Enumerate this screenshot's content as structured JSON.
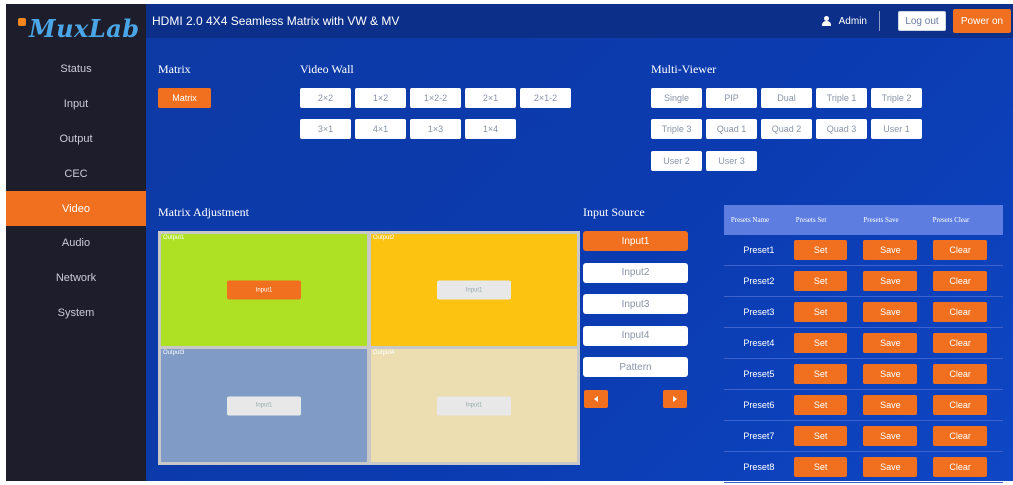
{
  "brand": {
    "logo_text": "MuxLab"
  },
  "header": {
    "title": "HDMI 2.0 4X4 Seamless Matrix with VW & MV",
    "user_name": "Admin",
    "logout_label": "Log out",
    "power_label": "Power on"
  },
  "sidebar": {
    "items": [
      {
        "label": "Status"
      },
      {
        "label": "Input"
      },
      {
        "label": "Output"
      },
      {
        "label": "CEC"
      },
      {
        "label": "Video",
        "active": true
      },
      {
        "label": "Audio"
      },
      {
        "label": "Network"
      },
      {
        "label": "System"
      }
    ]
  },
  "matrix": {
    "title": "Matrix",
    "button_label": "Matrix"
  },
  "video_wall": {
    "title": "Video Wall",
    "row1": [
      "2×2",
      "1×2",
      "1×2-2",
      "2×1",
      "2×1-2"
    ],
    "row2": [
      "3×1",
      "4×1",
      "1×3",
      "1×4"
    ]
  },
  "multi_viewer": {
    "title": "Multi-Viewer",
    "row1": [
      "Single",
      "PIP",
      "Dual",
      "Triple 1",
      "Triple 2"
    ],
    "row2": [
      "Triple 3",
      "Quad 1",
      "Quad 2",
      "Quad 3",
      "User 1"
    ],
    "row3": [
      "User 2",
      "User 3"
    ]
  },
  "matrix_adjustment": {
    "title": "Matrix Adjustment",
    "cells": [
      {
        "label": "Output1",
        "input": "Input1"
      },
      {
        "label": "Output2",
        "input": "Input1"
      },
      {
        "label": "Output3",
        "input": "Input1"
      },
      {
        "label": "Output4",
        "input": "Input1"
      }
    ]
  },
  "input_source": {
    "title": "Input Source",
    "items": [
      "Input1",
      "Input2",
      "Input3",
      "Input4",
      "Pattern"
    ]
  },
  "presets": {
    "headers": [
      "Presets Name",
      "Presets Set",
      "Presets Save",
      "Presets Clear"
    ],
    "set_label": "Set",
    "save_label": "Save",
    "clear_label": "Clear",
    "rows": [
      "Preset1",
      "Preset2",
      "Preset3",
      "Preset4",
      "Preset5",
      "Preset6",
      "Preset7",
      "Preset8"
    ]
  },
  "colors": {
    "accent": "#f07020",
    "header": "#0c2f8a",
    "sidebar": "#1d1d2b",
    "main_bg": "#0b3bb0",
    "output1": "#aee023",
    "output2": "#fcc311",
    "output3": "#7f9bc6",
    "output4": "#ecdeb0"
  }
}
